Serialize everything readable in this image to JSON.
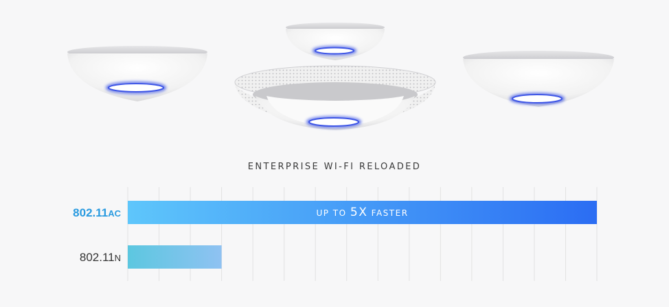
{
  "headline": "ENTERPRISE WI-FI RELOADED",
  "icons": [
    "ceiling-access-point-icon",
    "ceiling-access-point-icon",
    "ceiling-access-point-icon",
    "ceiling-access-point-icon"
  ],
  "colors": {
    "accent": "#2a9be0",
    "bar_ac_start": "#5ec6fb",
    "bar_ac_end": "#2b6df3",
    "bar_n_start": "#5cc7e0",
    "bar_n_end": "#8fc2f2",
    "gridline": "#e2e2e2",
    "led_ring": "#3d55e6"
  },
  "chart_data": {
    "type": "bar",
    "orientation": "horizontal",
    "categories": [
      {
        "main": "802.11",
        "suffix": "AC"
      },
      {
        "main": "802.11",
        "suffix": "N"
      }
    ],
    "values": [
      5,
      1
    ],
    "annotation": {
      "pre": "UP TO",
      "big": "5X",
      "post": "FASTER"
    },
    "xlim": [
      0,
      5
    ],
    "grid": true
  }
}
